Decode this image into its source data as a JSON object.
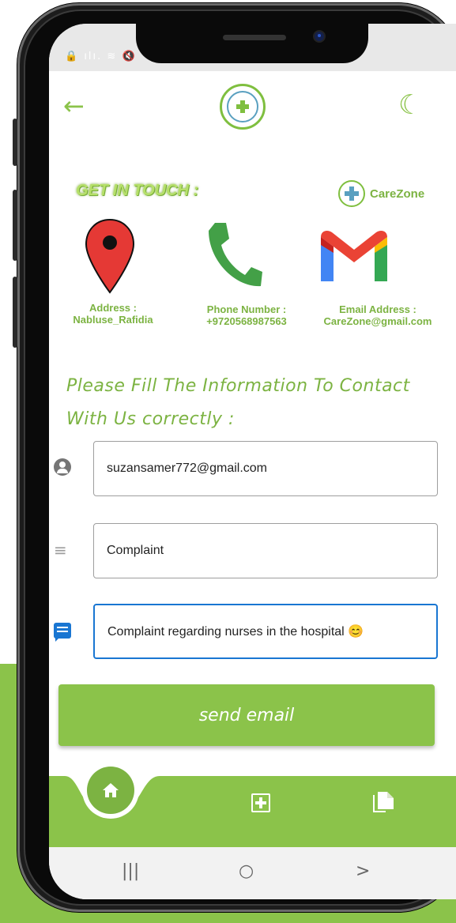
{
  "colors": {
    "accent": "#8bc34a",
    "accent_dark": "#7cb342",
    "focus": "#1976d2",
    "pin_red": "#e53935",
    "phone_green": "#43a047"
  },
  "status_bar": {
    "icons": "🔒 ılı. ≋ 🔇"
  },
  "app_bar": {
    "back_icon": "←",
    "theme_icon": "☾"
  },
  "header": {
    "get_in_touch": "GET IN TOUCH :",
    "brand_name": "CareZone"
  },
  "contacts": {
    "address_label": "Address :",
    "address_value": "Nabluse_Rafidia",
    "phone_label": "Phone Number :",
    "phone_value": "+9720568987563",
    "email_label": "Email Address :",
    "email_value": "CareZone@gmail.com"
  },
  "intro": {
    "line1": "Please Fill  The Information To Contact",
    "line2": "With Us correctly :"
  },
  "form": {
    "email_value": "suzansamer772@gmail.com",
    "subject_value": "Complaint",
    "message_value": "Complaint regarding nurses in the hospital 😊"
  },
  "send_button": {
    "label": "send email"
  },
  "system_nav": {
    "recent": "|||",
    "home": "○",
    "back": ">"
  }
}
